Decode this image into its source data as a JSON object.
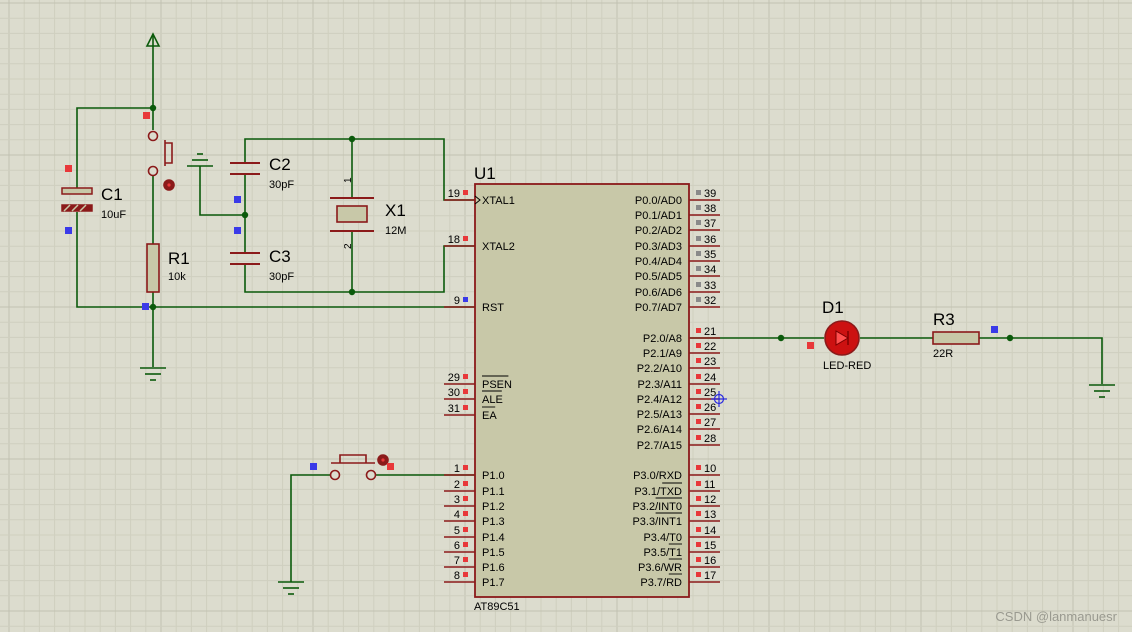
{
  "schematic": {
    "colors": {
      "background": "#dcdcce",
      "grid_minor": "#cfcfbf",
      "grid_major": "#c2c2b2",
      "wire": "#0b5a0b",
      "component": "#8b1a1a",
      "chip_fill": "#c8c8a8",
      "pin_marker": "#e8383a",
      "port_marker": "#3a3ae8",
      "led_red": "#cc1111",
      "label": "#000000"
    },
    "u1": {
      "ref": "U1",
      "part": "AT89C51",
      "left_pins": [
        {
          "num": "19",
          "name": "XTAL1"
        },
        {
          "num": "18",
          "name": "XTAL2"
        },
        {
          "num": "9",
          "name": "RST"
        },
        {
          "num": "29",
          "name": "PSEN"
        },
        {
          "num": "30",
          "name": "ALE"
        },
        {
          "num": "31",
          "name": "EA"
        },
        {
          "num": "1",
          "name": "P1.0"
        },
        {
          "num": "2",
          "name": "P1.1"
        },
        {
          "num": "3",
          "name": "P1.2"
        },
        {
          "num": "4",
          "name": "P1.3"
        },
        {
          "num": "5",
          "name": "P1.4"
        },
        {
          "num": "6",
          "name": "P1.5"
        },
        {
          "num": "7",
          "name": "P1.6"
        },
        {
          "num": "8",
          "name": "P1.7"
        }
      ],
      "right_pins": [
        {
          "num": "39",
          "name": "P0.0/AD0"
        },
        {
          "num": "38",
          "name": "P0.1/AD1"
        },
        {
          "num": "37",
          "name": "P0.2/AD2"
        },
        {
          "num": "36",
          "name": "P0.3/AD3"
        },
        {
          "num": "35",
          "name": "P0.4/AD4"
        },
        {
          "num": "34",
          "name": "P0.5/AD5"
        },
        {
          "num": "33",
          "name": "P0.6/AD6"
        },
        {
          "num": "32",
          "name": "P0.7/AD7"
        },
        {
          "num": "21",
          "name": "P2.0/A8"
        },
        {
          "num": "22",
          "name": "P2.1/A9"
        },
        {
          "num": "23",
          "name": "P2.2/A10"
        },
        {
          "num": "24",
          "name": "P2.3/A11"
        },
        {
          "num": "25",
          "name": "P2.4/A12"
        },
        {
          "num": "26",
          "name": "P2.5/A13"
        },
        {
          "num": "27",
          "name": "P2.6/A14"
        },
        {
          "num": "28",
          "name": "P2.7/A15"
        },
        {
          "num": "10",
          "name": "P3.0/RXD"
        },
        {
          "num": "11",
          "name": "P3.1/TXD"
        },
        {
          "num": "12",
          "name": "P3.2/INT0"
        },
        {
          "num": "13",
          "name": "P3.3/INT1"
        },
        {
          "num": "14",
          "name": "P3.4/T0"
        },
        {
          "num": "15",
          "name": "P3.5/T1"
        },
        {
          "num": "16",
          "name": "P3.6/WR"
        },
        {
          "num": "17",
          "name": "P3.7/RD"
        }
      ]
    },
    "c1": {
      "ref": "C1",
      "value": "10uF"
    },
    "c2": {
      "ref": "C2",
      "value": "30pF"
    },
    "c3": {
      "ref": "C3",
      "value": "30pF"
    },
    "x1": {
      "ref": "X1",
      "value": "12M",
      "pin1": "1",
      "pin2": "2"
    },
    "r1": {
      "ref": "R1",
      "value": "10k"
    },
    "r3": {
      "ref": "R3",
      "value": "22R"
    },
    "d1": {
      "ref": "D1",
      "value": "LED-RED"
    },
    "watermark": "CSDN @lanmanuesr"
  }
}
